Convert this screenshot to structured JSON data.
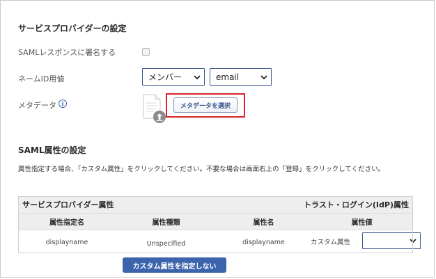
{
  "sp_settings": {
    "title": "サービスプロバイダーの設定",
    "sign_response_label": "SAMLレスポンスに署名する",
    "name_id_label": "ネームID用値",
    "name_id_type": "メンバー",
    "name_id_value": "email",
    "metadata_label": "メタデータ",
    "metadata_info_glyph": "i",
    "metadata_button": "メタデータを選択"
  },
  "saml_attrs": {
    "title": "SAML属性の設定",
    "description": "属性指定する場合、「カスタム属性」をクリックしてください。不要な場合は画面右上の「登録」をクリックしてください。",
    "table": {
      "left_header": "サービスプロバイダー属性",
      "right_header": "トラスト・ログイン(IdP)属性",
      "columns": [
        "属性指定名",
        "属性種類",
        "属性名",
        "属性値"
      ],
      "rows": [
        {
          "name": "displayname",
          "type": "Unspecified",
          "attr": "displayname",
          "value_label": "カスタム属性",
          "value_select": ""
        }
      ]
    },
    "no_custom_button": "カスタム属性を指定しない"
  },
  "colors": {
    "accent": "#3b64ad",
    "highlight": "#d8232a",
    "select_border": "#3b5b8c"
  },
  "icons": {
    "file": "document-upload-icon",
    "info": "info-icon",
    "chevron": "chevron-down-icon"
  }
}
